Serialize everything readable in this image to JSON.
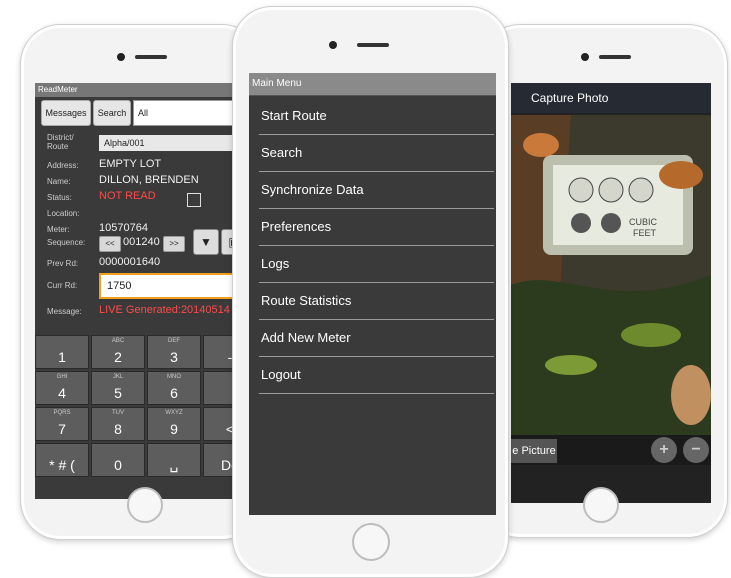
{
  "left": {
    "title": "ReadMeter",
    "messages_btn": "Messages",
    "search_btn": "Search",
    "filter_value": "All",
    "labels": {
      "district": "District/\nRoute",
      "address": "Address:",
      "name": "Name:",
      "status": "Status:",
      "location": "Location:",
      "meter": "Meter:",
      "sequence": "Sequence:",
      "prev": "Prev Rd:",
      "curr": "Curr Rd:",
      "message": "Message:"
    },
    "values": {
      "district": "Alpha/001",
      "address": "EMPTY LOT",
      "name": "DILLON, BRENDEN",
      "status": "NOT READ",
      "meter": "10570764",
      "sequence": "001240",
      "prev": "0000001640",
      "curr": "1750",
      "message": "LIVE Generated:20140514"
    },
    "seq_prev": "<<",
    "seq_next": ">>",
    "keys": [
      {
        "sub": "",
        "main": "1"
      },
      {
        "sub": "ABC",
        "main": "2"
      },
      {
        "sub": "DEF",
        "main": "3"
      },
      {
        "sub": "",
        "main": "-"
      },
      {
        "sub": "GHI",
        "main": "4"
      },
      {
        "sub": "JKL",
        "main": "5"
      },
      {
        "sub": "MNO",
        "main": "6"
      },
      {
        "sub": "",
        "main": ""
      },
      {
        "sub": "PQRS",
        "main": "7"
      },
      {
        "sub": "TUV",
        "main": "8"
      },
      {
        "sub": "WXYZ",
        "main": "9"
      },
      {
        "sub": "",
        "main": "<"
      },
      {
        "sub": "",
        "main": "* # ("
      },
      {
        "sub": "",
        "main": "0"
      },
      {
        "sub": "",
        "main": "␣"
      },
      {
        "sub": "",
        "main": "Do"
      }
    ]
  },
  "center": {
    "title": "Main Menu",
    "items": [
      "Start Route",
      "Search",
      "Synchronize Data",
      "Preferences",
      "Logs",
      "Route Statistics",
      "Add New Meter",
      "Logout"
    ]
  },
  "right": {
    "title": "Capture Photo",
    "meter_text": "CUBIC\nFEET",
    "take_picture": "e Picture",
    "zoom_in": "+",
    "zoom_out": "−"
  }
}
